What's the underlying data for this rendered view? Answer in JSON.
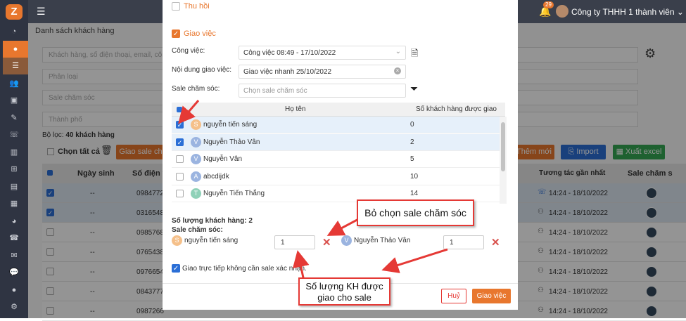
{
  "topbar": {
    "menu_icon": "menu-icon",
    "bell_count": "29",
    "company": "Công ty THHH 1 thành viên"
  },
  "sidebar": {
    "logo": "Z",
    "icons": [
      "dashboard-icon",
      "user-icon",
      "list-icon",
      "users-icon",
      "briefcase-icon",
      "edit-icon",
      "phone-icon",
      "chart-icon",
      "org-icon",
      "file-icon",
      "doc-icon",
      "pie-icon",
      "call-icon",
      "mail-icon",
      "chat-icon",
      "person-icon",
      "settings-icon"
    ]
  },
  "page": {
    "title": "Danh sách khách hàng",
    "search_placeholder": "Khách hàng, số điện thoại, email, công việ",
    "filters": [
      "Phân loại",
      "",
      "Sale chăm sóc",
      "",
      "Thành phố"
    ],
    "filter_count_prefix": "Bộ lọc:",
    "filter_count": "40 khách hàng",
    "select_all": "Chọn tất cả",
    "btn_assign": "Giao sale ch",
    "btn_add": "Thêm mới",
    "btn_import": "Import",
    "btn_export": "Xuất excel",
    "columns": [
      "Ngày sinh",
      "Số điện t",
      "Tương tác gần nhất",
      "Sale chăm s"
    ],
    "rows": [
      {
        "dob": "--",
        "phone": "0984772",
        "last": "14:24 - 18/10/2022",
        "selected": true
      },
      {
        "dob": "--",
        "phone": "0316548",
        "last": "14:24 - 18/10/2022",
        "selected": true
      },
      {
        "dob": "--",
        "phone": "0985768",
        "last": "14:24 - 18/10/2022",
        "selected": false
      },
      {
        "dob": "--",
        "phone": "0765438",
        "last": "14:24 - 18/10/2022",
        "selected": false
      },
      {
        "dob": "--",
        "phone": "0976654",
        "last": "14:24 - 18/10/2022",
        "selected": false
      },
      {
        "dob": "--",
        "phone": "0843777",
        "last": "14:24 - 18/10/2022",
        "selected": false
      },
      {
        "dob": "--",
        "phone": "0987266",
        "last": "14:24 - 18/10/2022",
        "selected": false
      }
    ]
  },
  "modal": {
    "thu_hoi": "Thu hồi",
    "giao_viec": "Giao việc",
    "cong_viec_label": "Công việc:",
    "cong_viec_value": "Công việc 08:49 - 17/10/2022",
    "noi_dung_label": "Nội dung giao việc:",
    "noi_dung_value": "Giao việc nhanh 25/10/2022",
    "sale_label": "Sale chăm sóc:",
    "sale_placeholder": "Chọn sale chăm sóc",
    "col_name": "Họ tên",
    "col_count": "Số khách hàng được giao",
    "staff": [
      {
        "initial": "S",
        "name": "nguyễn tiến sáng",
        "count": "0",
        "checked": true,
        "color": "#f5c08a"
      },
      {
        "initial": "V",
        "name": "Nguyễn Thảo Vân",
        "count": "2",
        "checked": true,
        "color": "#9bb4e0"
      },
      {
        "initial": "V",
        "name": "Nguyễn Vân",
        "count": "5",
        "checked": false,
        "color": "#9bb4e0"
      },
      {
        "initial": "A",
        "name": "abcdijdk",
        "count": "10",
        "checked": false,
        "color": "#9bb4e0"
      },
      {
        "initial": "T",
        "name": "Nguyễn Tiến Thắng",
        "count": "14",
        "checked": false,
        "color": "#8fd1b8"
      }
    ],
    "so_luong_label": "Số lượng khách hàng: 2",
    "sale_cham_soc_label": "Sale chăm sóc:",
    "assigned": [
      {
        "initial": "S",
        "name": "nguyễn tiến sáng",
        "qty": "1",
        "color": "#f5c08a"
      },
      {
        "initial": "V",
        "name": "Nguyễn Thảo Vân",
        "qty": "1",
        "color": "#9bb4e0"
      }
    ],
    "direct": "Giao trực tiếp không cần sale xác nhận.",
    "btn_cancel": "Huỷ",
    "btn_submit": "Giao việc"
  },
  "callouts": {
    "unselect": "Bỏ chọn sale chăm sóc",
    "count": "Số lượng KH được giao cho sale"
  },
  "colors": {
    "accent": "#e8772e",
    "blue": "#2b6fd6",
    "green": "#34a853",
    "red": "#e53935"
  }
}
